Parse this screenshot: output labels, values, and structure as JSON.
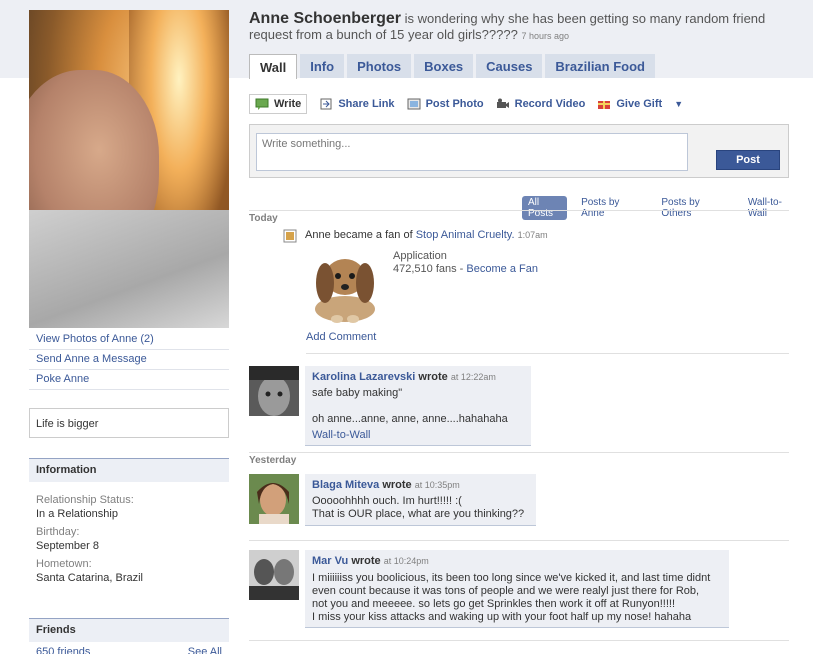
{
  "profile": {
    "name": "Anne Schoenberger",
    "status": "is wondering why she has been getting so many random friend request from a bunch of 15 year old girls?????",
    "status_time": "7 hours ago"
  },
  "left": {
    "links": [
      "View Photos of Anne (2)",
      "Send Anne a Message",
      "Poke Anne"
    ],
    "status_box": "Life is bigger",
    "info_title": "Information",
    "info": [
      {
        "label": "Relationship Status:",
        "value": "In a Relationship"
      },
      {
        "label": "Birthday:",
        "value": "September 8"
      },
      {
        "label": "Hometown:",
        "value": "Santa Catarina, Brazil"
      }
    ],
    "friends_title": "Friends",
    "friends_count": "650 friends",
    "see_all": "See All"
  },
  "tabs": [
    "Wall",
    "Info",
    "Photos",
    "Boxes",
    "Causes",
    "Brazilian Food"
  ],
  "actions": [
    "Write",
    "Share Link",
    "Post Photo",
    "Record Video",
    "Give Gift"
  ],
  "composer": {
    "placeholder": "Write something...",
    "post_label": "Post"
  },
  "filters": [
    "All Posts",
    "Posts by Anne",
    "Posts by Others",
    "Wall-to-Wall"
  ],
  "days": {
    "today": "Today",
    "yesterday": "Yesterday"
  },
  "fan_story": {
    "prefix": "Anne became a fan of",
    "page": "Stop Animal Cruelty.",
    "time": "1:07am",
    "app_label": "Application",
    "fans": "472,510 fans -",
    "become_fan": "Become a Fan",
    "add_comment": "Add Comment"
  },
  "posts": [
    {
      "author": "Karolina Lazarevski",
      "wrote": "wrote",
      "time": "at 12:22am",
      "lines": [
        "safe baby making\"",
        "",
        "oh anne...anne, anne, anne....hahahaha"
      ],
      "link": "Wall-to-Wall"
    },
    {
      "author": "Blaga Miteva",
      "wrote": "wrote",
      "time": "at 10:35pm",
      "lines": [
        "Ooooohhhh ouch. Im hurt!!!!! :(",
        "That is OUR place, what are you thinking??"
      ]
    },
    {
      "author": "Mar Vu",
      "wrote": "wrote",
      "time": "at 10:24pm",
      "lines": [
        "I miiiiiiss you boolicious, its been too long since we've kicked it, and last time didnt",
        "even count because it was tons of people and we were realyl just there for Rob,",
        "not you and meeeee. so lets go get Sprinkles then work it off at Runyon!!!!!",
        "I miss your kiss attacks and waking up with your foot half up my nose! hahaha"
      ]
    }
  ],
  "colors": {
    "link": "#3b5998",
    "tab_bg": "#d8dfea",
    "post_button": "#3b5998",
    "top_band": "#edeff4"
  }
}
